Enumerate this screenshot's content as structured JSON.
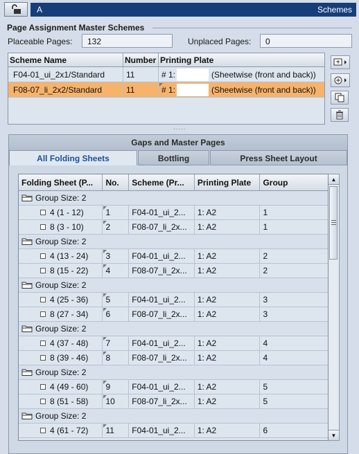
{
  "titlebar": {
    "left": "A",
    "right": "Schemes"
  },
  "section": {
    "title": "Page Assignment  Master Schemes"
  },
  "counts": {
    "placeable_label": "Placeable Pages:",
    "placeable_value": "132",
    "unplaced_label": "Unplaced Pages:",
    "unplaced_value": "0"
  },
  "scheme_table": {
    "headers": [
      "Scheme Name",
      "Number",
      "Printing Plate"
    ],
    "rows": [
      {
        "name": "F04-01_ui_2x1/Standard",
        "number": "11",
        "plate_prefix": "# 1:",
        "plate_suffix": "(Sheetwise (front and back))",
        "selected": false
      },
      {
        "name": "F08-07_li_2x2/Standard",
        "number": "11",
        "plate_prefix": "# 1:",
        "plate_suffix": "(Sheetwise (front and back))",
        "selected": true
      }
    ]
  },
  "bottom": {
    "title": "Gaps and Master Pages",
    "tabs": [
      "All Folding Sheets",
      "Bottling",
      "Press Sheet Layout"
    ],
    "active_tab": 0
  },
  "fold_table": {
    "headers": [
      "Folding Sheet (P...",
      "No.",
      "Scheme (Pr...",
      "Printing Plate",
      "Group"
    ],
    "rows": [
      {
        "group": "Group Size: 2"
      },
      {
        "sheet": "4 (1 - 12)",
        "no": "1",
        "scheme": "F04-01_ui_2...",
        "plate": "1: A2",
        "grp": "1"
      },
      {
        "sheet": "8 (3 - 10)",
        "no": "2",
        "scheme": "F08-07_li_2x...",
        "plate": "1: A2",
        "grp": "1"
      },
      {
        "group": "Group Size: 2"
      },
      {
        "sheet": "4 (13 - 24)",
        "no": "3",
        "scheme": "F04-01_ui_2...",
        "plate": "1: A2",
        "grp": "2"
      },
      {
        "sheet": "8 (15 - 22)",
        "no": "4",
        "scheme": "F08-07_li_2x...",
        "plate": "1: A2",
        "grp": "2"
      },
      {
        "group": "Group Size: 2"
      },
      {
        "sheet": "4 (25 - 36)",
        "no": "5",
        "scheme": "F04-01_ui_2...",
        "plate": "1: A2",
        "grp": "3"
      },
      {
        "sheet": "8 (27 - 34)",
        "no": "6",
        "scheme": "F08-07_li_2x...",
        "plate": "1: A2",
        "grp": "3"
      },
      {
        "group": "Group Size: 2"
      },
      {
        "sheet": "4 (37 - 48)",
        "no": "7",
        "scheme": "F04-01_ui_2...",
        "plate": "1: A2",
        "grp": "4"
      },
      {
        "sheet": "8 (39 - 46)",
        "no": "8",
        "scheme": "F08-07_li_2x...",
        "plate": "1: A2",
        "grp": "4"
      },
      {
        "group": "Group Size: 2"
      },
      {
        "sheet": "4 (49 - 60)",
        "no": "9",
        "scheme": "F04-01_ui_2...",
        "plate": "1: A2",
        "grp": "5"
      },
      {
        "sheet": "8 (51 - 58)",
        "no": "10",
        "scheme": "F08-07_li_2x...",
        "plate": "1: A2",
        "grp": "5"
      },
      {
        "group": "Group Size: 2"
      },
      {
        "sheet": "4 (61 - 72)",
        "no": "11",
        "scheme": "F04-01_ui_2...",
        "plate": "1: A2",
        "grp": "6"
      }
    ]
  },
  "colors": {
    "title_strip": "#163f79",
    "selected_row": "#f6b36c",
    "active_tab_text": "#1f4f9a"
  },
  "icons": [
    "lock-open-icon",
    "assign-scheme-icon",
    "add-scheme-icon",
    "copy-scheme-icon",
    "trash-icon",
    "folder-icon"
  ]
}
